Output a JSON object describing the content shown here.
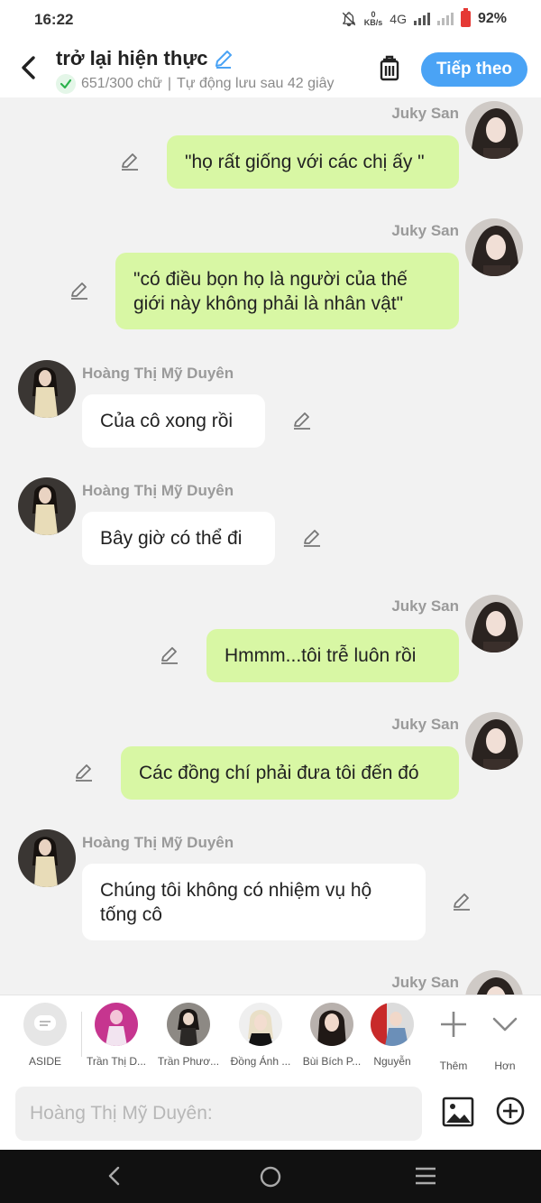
{
  "status": {
    "time": "16:22",
    "speed_value": "0",
    "speed_unit": "KB/s",
    "network": "4G",
    "battery": "92%"
  },
  "header": {
    "title": "trở lại hiện thực",
    "counter": "651/300 chữ",
    "autosave": "Tự động lưu sau 42 giây",
    "next_label": "Tiếp theo"
  },
  "messages": [
    {
      "sender": "Juky San",
      "side": "right",
      "text": "\"họ rất giống với các chị ấy \""
    },
    {
      "sender": "Juky San",
      "side": "right",
      "text": "\"có điều bọn họ là người của thế giới này không phải là nhân vật\""
    },
    {
      "sender": "Hoàng Thị Mỹ Duyên",
      "side": "left",
      "text": "Của cô xong rồi"
    },
    {
      "sender": "Hoàng Thị Mỹ Duyên",
      "side": "left",
      "text": "Bây giờ có thể đi"
    },
    {
      "sender": "Juky San",
      "side": "right",
      "text": "Hmmm...tôi trễ luôn rồi"
    },
    {
      "sender": "Juky San",
      "side": "right",
      "text": "Các đồng chí phải đưa tôi đến đó"
    },
    {
      "sender": "Hoàng Thị Mỹ Duyên",
      "side": "left",
      "text": "Chúng tôi không có nhiệm vụ hộ tống cô"
    },
    {
      "sender": "Juky San",
      "side": "right",
      "text": ""
    }
  ],
  "characters": [
    {
      "label": "ASIDE"
    },
    {
      "label": "Trần Thị D..."
    },
    {
      "label": "Trần Phươ..."
    },
    {
      "label": "Đồng Ánh ..."
    },
    {
      "label": "Bùi Bích P..."
    },
    {
      "label": "Nguyễn"
    }
  ],
  "toolbar": {
    "add_label": "Thêm",
    "more_label": "Hơn"
  },
  "input": {
    "placeholder": "Hoàng Thị Mỹ Duyên:"
  },
  "colors": {
    "accent": "#4aa3f5",
    "my_bubble": "#d8f7a4",
    "other_bubble": "#ffffff",
    "background": "#f2f2f2",
    "success": "#2bb24c"
  }
}
